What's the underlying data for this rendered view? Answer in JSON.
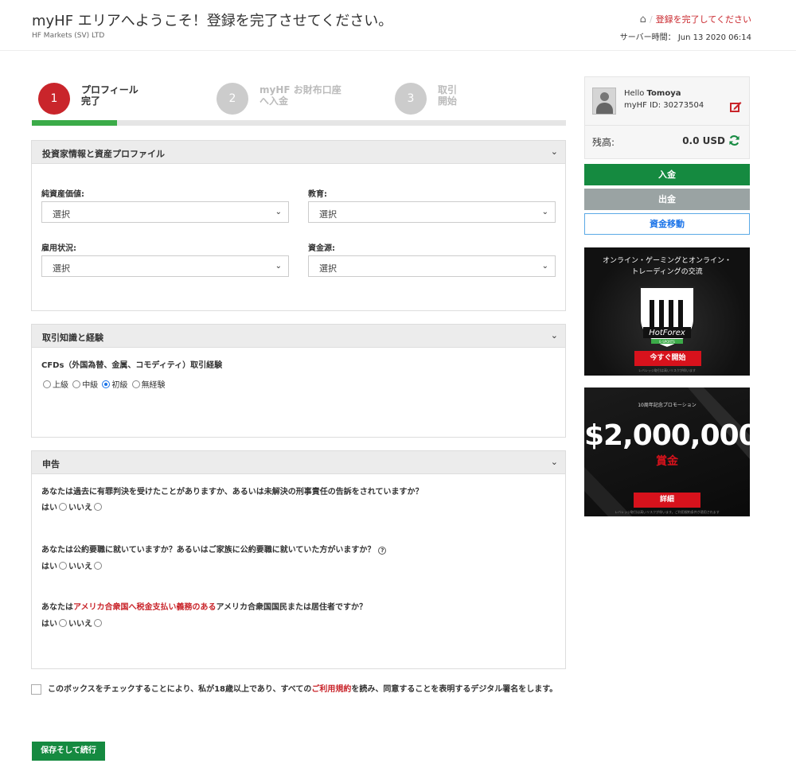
{
  "header": {
    "title": "myHF エリアへようこそ！登録を完了させてください。",
    "company": "HF Markets (SV) LTD",
    "breadcrumb": "登録を完了してください",
    "server_time_label": "サーバー時間：",
    "server_time": "Jun 13 2020 06:14"
  },
  "steps": [
    {
      "num": "1",
      "line1": "プロフィール",
      "line2": "完了"
    },
    {
      "num": "2",
      "line1": "myHF お財布口座",
      "line2": "へ入金"
    },
    {
      "num": "3",
      "line1": "取引",
      "line2": "開始"
    }
  ],
  "progress": 0.16,
  "investor_panel": {
    "title": "投資家情報と資産プロファイル",
    "fields": [
      {
        "label": "純資産価値:",
        "value": "選択"
      },
      {
        "label": "教育:",
        "value": "選択"
      },
      {
        "label": "雇用状況:",
        "value": "選択"
      },
      {
        "label": "資金源:",
        "value": "選択"
      }
    ]
  },
  "knowledge_panel": {
    "title": "取引知識と経験",
    "question": "CFDs（外国為替、金属、コモディティ）取引経験",
    "options": [
      "上級",
      "中級",
      "初級",
      "無経験"
    ],
    "selected": "初級"
  },
  "declaration_panel": {
    "title": "申告",
    "q1": "あなたは過去に有罪判決を受けたことがありますか、あるいは未解決の刑事責任の告訴をされていますか？",
    "q2": "あなたは公約要職に就いていますか？あるいはご家族に公約要職に就いていた方がいますか？",
    "q3_prefix": "あなたは",
    "q3_link": "アメリカ合衆国へ税金支払い義務のある",
    "q3_suffix": "アメリカ合衆国国民または居住者ですか？",
    "yes": "はい",
    "no": "いいえ"
  },
  "consent": {
    "prefix": "このボックスをチェックすることにより、私が18歳以上であり、すべての",
    "link": "ご利用規約",
    "suffix": "を読み、同意することを表明するデジタル署名をします。"
  },
  "save_button": "保存そして続行",
  "sidebar": {
    "hello": "Hello",
    "username": "Tomoya",
    "user_id": "myHF ID: 30273504",
    "balance_label": "残高:",
    "balance_value": "0.0 USD",
    "deposit": "入金",
    "withdraw": "出金",
    "transfer": "資金移動"
  },
  "ad1": {
    "line1": "オンライン・ゲーミングとオンライン・",
    "line2": "トレーディングの交流",
    "brand": "HotForex",
    "brand_sub": "E-SPORTS",
    "cta": "今すぐ開始",
    "fine": "レバレッジ取引は高いリスクが伴います"
  },
  "ad2": {
    "top": "10周年記念プロモーション",
    "amount": "$2,000,000",
    "prize": "賞金",
    "cta": "詳細",
    "fine": "レバレッジ取引は高いリスクが伴います。ご利用規約条件が適用されます"
  },
  "colors": {
    "brand_red": "#c9252b",
    "green": "#158a40",
    "progress_green": "#3bab48"
  }
}
